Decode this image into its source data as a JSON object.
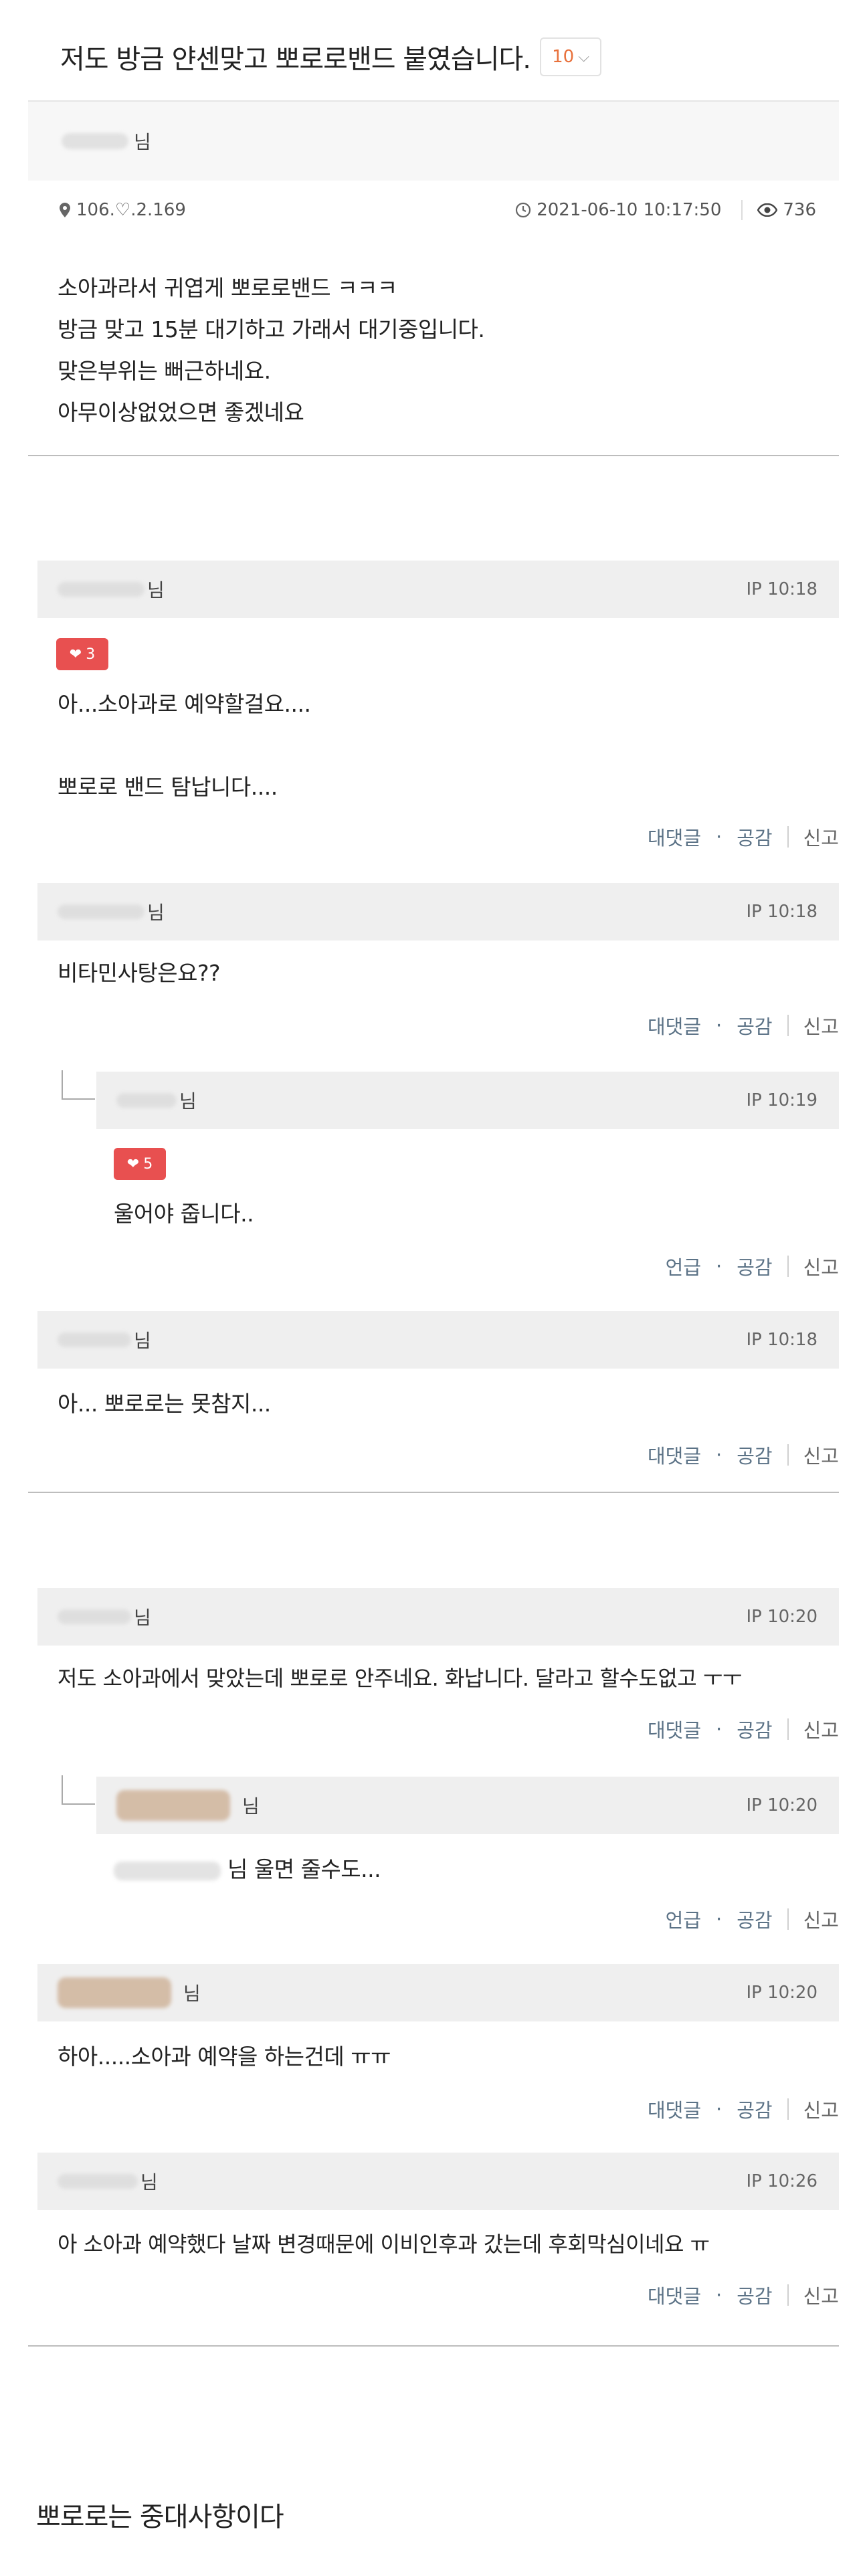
{
  "post": {
    "title": "저도 방금 얀센맞고 뽀로로밴드 붙였습니다.",
    "comment_count": "10",
    "author_suffix": "님",
    "ip": "106.♡.2.169",
    "datetime": "2021-06-10 10:17:50",
    "views": "736",
    "body_lines": [
      "소아과라서 귀엽게 뽀로로밴드 ㅋㅋㅋ",
      "방금 맞고 15분 대기하고 가래서 대기중입니다.",
      "맞은부위는 뻐근하네요.",
      "아무이상없었으면 좋겠네요"
    ]
  },
  "labels": {
    "nim": "님",
    "reply": "대댓글",
    "mention": "언급",
    "like": "공감",
    "report": "신고",
    "dot": "·"
  },
  "comments": [
    {
      "time": "IP 10:18",
      "likes": "3",
      "lines": [
        "아...소아과로 예약할걸요....",
        "뽀로로 밴드 탐납니다...."
      ],
      "action": "대댓글"
    },
    {
      "time": "IP 10:18",
      "lines": [
        "비타민사탕은요??"
      ],
      "action": "대댓글"
    },
    {
      "time": "IP 10:19",
      "likes": "5",
      "lines": [
        "울어야 줍니다.."
      ],
      "action": "언급",
      "reply": true
    },
    {
      "time": "IP 10:18",
      "lines": [
        "아... 뽀로로는 못참지..."
      ],
      "action": "대댓글"
    },
    {
      "time": "IP 10:20",
      "lines": [
        "저도 소아과에서 맞았는데 뽀로로 안주네요. 화납니다. 달라고 할수도없고 ㅜㅜ"
      ],
      "action": "대댓글"
    },
    {
      "time": "IP 10:20",
      "lines": [
        "님 울면 줄수도..."
      ],
      "action": "언급",
      "reply": true
    },
    {
      "time": "IP 10:20",
      "lines": [
        "하아.....소아과 예약을 하는건데 ㅠㅠ"
      ],
      "action": "대댓글"
    },
    {
      "time": "IP 10:26",
      "lines": [
        "아 소아과 예약했다 날짜 변경때문에 이비인후과 갔는데 후회막심이네요 ㅠ"
      ],
      "action": "대댓글"
    }
  ],
  "caption": "뽀로로는 중대사항이다"
}
